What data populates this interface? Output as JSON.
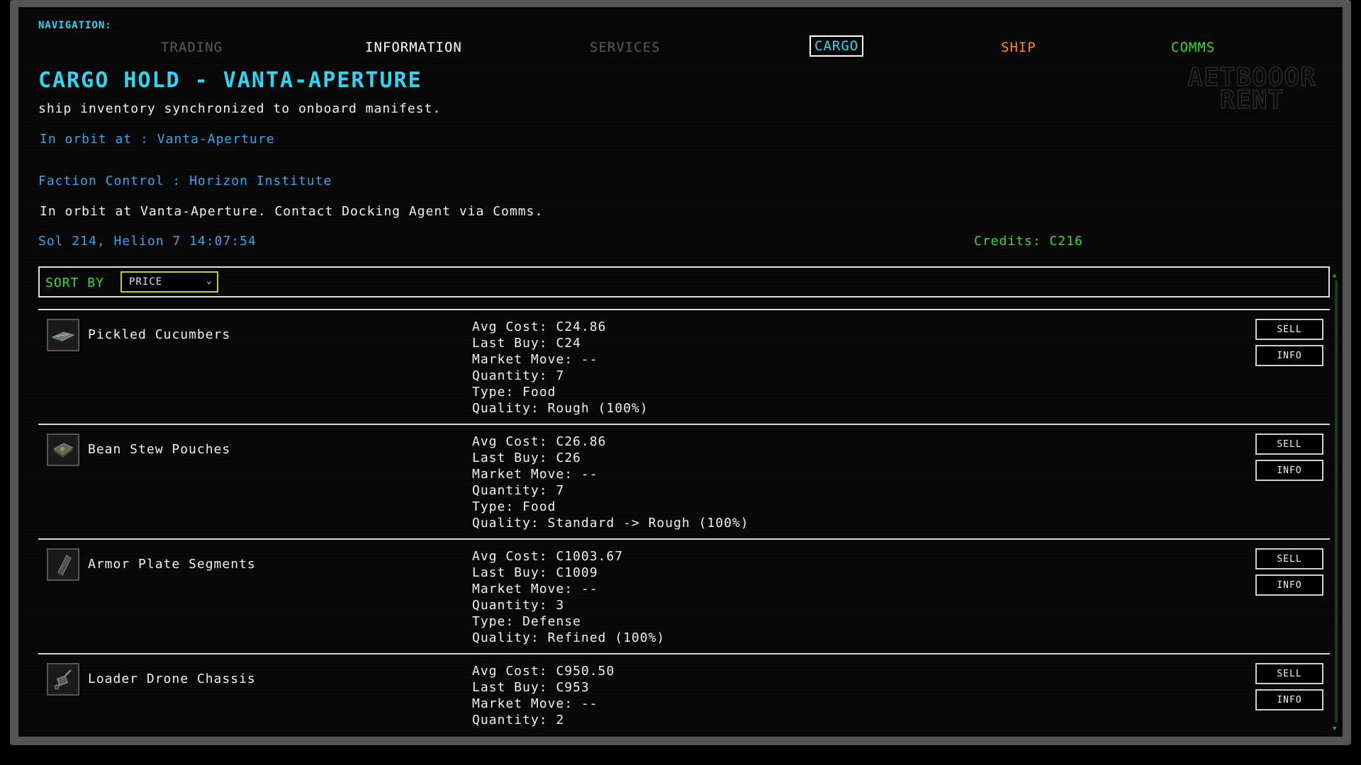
{
  "nav": {
    "label": "NAVIGATION:",
    "items": [
      {
        "label": "TRADING"
      },
      {
        "label": "INFORMATION"
      },
      {
        "label": "SERVICES"
      },
      {
        "label": "CARGO"
      },
      {
        "label": "SHIP"
      },
      {
        "label": "COMMS"
      }
    ]
  },
  "header": {
    "title": "CARGO HOLD - VANTA-APERTURE",
    "subtitle": "ship inventory synchronized to onboard manifest.",
    "logo_line1": "AETBOOOR",
    "logo_line2": "RENT"
  },
  "info": {
    "orbit": "In orbit at : Vanta-Aperture",
    "faction": "Faction Control : Horizon Institute",
    "status": "In orbit at Vanta-Aperture. Contact Docking Agent via Comms.",
    "time": "Sol 214, Helion 7 14:07:54",
    "credits": "Credits: C216"
  },
  "sort": {
    "label": "SORT BY",
    "selected": "PRICE"
  },
  "buttons": {
    "sell": "SELL",
    "info": "INFO"
  },
  "cargo": [
    {
      "name": "Pickled Cucumbers",
      "icon": "pickled-cucumbers-icon",
      "avg_cost": "Avg Cost: C24.86",
      "last_buy": "Last Buy: C24",
      "market_move": "Market Move: --",
      "quantity": "Quantity: 7",
      "type": "Type: Food",
      "quality": "Quality: Rough (100%)"
    },
    {
      "name": "Bean Stew Pouches",
      "icon": "bean-stew-pouches-icon",
      "avg_cost": "Avg Cost: C26.86",
      "last_buy": "Last Buy: C26",
      "market_move": "Market Move: --",
      "quantity": "Quantity: 7",
      "type": "Type: Food",
      "quality": "Quality: Standard -> Rough (100%)"
    },
    {
      "name": "Armor Plate Segments",
      "icon": "armor-plate-segments-icon",
      "avg_cost": "Avg Cost: C1003.67",
      "last_buy": "Last Buy: C1009",
      "market_move": "Market Move: --",
      "quantity": "Quantity: 3",
      "type": "Type: Defense",
      "quality": "Quality: Refined (100%)"
    },
    {
      "name": "Loader Drone Chassis",
      "icon": "loader-drone-chassis-icon",
      "avg_cost": "Avg Cost: C950.50",
      "last_buy": "Last Buy: C953",
      "market_move": "Market Move: --",
      "quantity": "Quantity: 2",
      "type": "",
      "quality": ""
    }
  ]
}
